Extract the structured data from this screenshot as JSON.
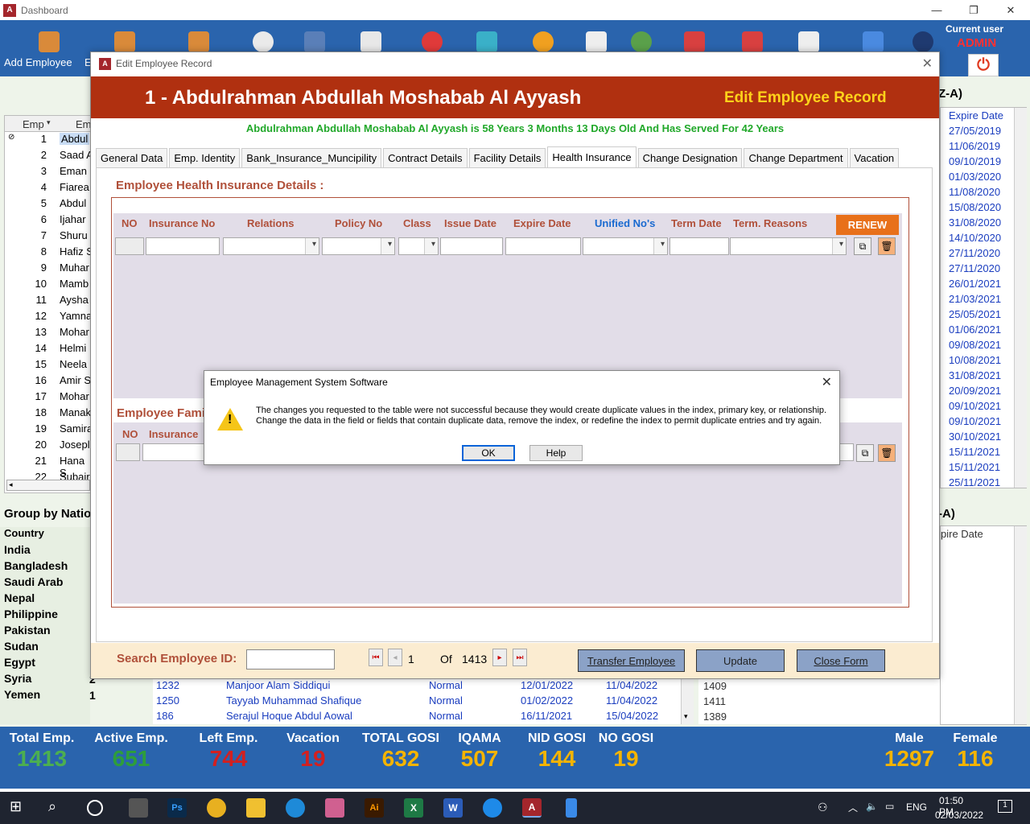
{
  "app": {
    "title": "Dashboard"
  },
  "ribbon": {
    "add_employee": "Add Employee",
    "next_label": "E",
    "current_user_label": "Current user",
    "user": "ADMIN"
  },
  "left_grid": {
    "headers": [
      "Emp",
      "Em"
    ],
    "rows": [
      {
        "n": "1",
        "name": "Abdul"
      },
      {
        "n": "2",
        "name": "Saad A"
      },
      {
        "n": "3",
        "name": "Eman"
      },
      {
        "n": "4",
        "name": "Fiarea"
      },
      {
        "n": "5",
        "name": "Abdul"
      },
      {
        "n": "6",
        "name": "Ijahar"
      },
      {
        "n": "7",
        "name": "Shuru"
      },
      {
        "n": "8",
        "name": "Hafiz S"
      },
      {
        "n": "9",
        "name": "Muhar"
      },
      {
        "n": "10",
        "name": "Mamb"
      },
      {
        "n": "11",
        "name": "Aysha"
      },
      {
        "n": "12",
        "name": "Yamna"
      },
      {
        "n": "13",
        "name": "Mohar"
      },
      {
        "n": "14",
        "name": "Helmi"
      },
      {
        "n": "15",
        "name": "Neela"
      },
      {
        "n": "16",
        "name": "Amir S"
      },
      {
        "n": "17",
        "name": "Mohar"
      },
      {
        "n": "18",
        "name": "Manak"
      },
      {
        "n": "19",
        "name": "Samira"
      },
      {
        "n": "20",
        "name": "Josepl"
      },
      {
        "n": "21",
        "name": "Hana S"
      },
      {
        "n": "22",
        "name": "Subair"
      }
    ]
  },
  "right_grid": {
    "title": "Z-A)",
    "header": "Expire Date",
    "dates": [
      "27/05/2019",
      "11/06/2019",
      "09/10/2019",
      "01/03/2020",
      "11/08/2020",
      "15/08/2020",
      "31/08/2020",
      "14/10/2020",
      "27/11/2020",
      "27/11/2020",
      "26/01/2021",
      "21/03/2021",
      "25/05/2021",
      "01/06/2021",
      "09/08/2021",
      "10/08/2021",
      "31/08/2021",
      "20/09/2021",
      "09/10/2021",
      "09/10/2021",
      "30/10/2021",
      "15/11/2021",
      "15/11/2021",
      "25/11/2021"
    ]
  },
  "right_grid2": {
    "title": "-A)",
    "header": "pire Date"
  },
  "group_nat": {
    "title": "Group by Natio",
    "header": "Country",
    "countries": [
      "India",
      "Bangladesh",
      "Saudi Arab",
      "Nepal",
      "Philippine",
      "Pakistan",
      "Sudan",
      "Egypt",
      "Syria",
      "Yemen"
    ],
    "counts": [
      "2",
      "1"
    ]
  },
  "bottom_rows": [
    {
      "id": "1232",
      "name": "Manjoor Alam Siddiqui",
      "type": "Normal",
      "d1": "12/01/2022",
      "d2": "11/04/2022",
      "c": "1409"
    },
    {
      "id": "1250",
      "name": "Tayyab Muhammad Shafique",
      "type": "Normal",
      "d1": "01/02/2022",
      "d2": "11/04/2022",
      "c": "1411"
    },
    {
      "id": "186",
      "name": "Serajul Hoque Abdul Aowal",
      "type": "Normal",
      "d1": "16/11/2021",
      "d2": "15/04/2022",
      "c": "1389"
    }
  ],
  "stats": [
    {
      "label": "Total Emp.",
      "value": "1413",
      "color": "#4caf50"
    },
    {
      "label": "Active Emp.",
      "value": "651",
      "color": "#2e9e3a"
    },
    {
      "label": "Left Emp.",
      "value": "744",
      "color": "#d32020"
    },
    {
      "label": "Vacation",
      "value": "19",
      "color": "#d32020"
    },
    {
      "label": "TOTAL GOSI",
      "value": "632",
      "color": "#f5b400"
    },
    {
      "label": "IQAMA",
      "value": "507",
      "color": "#f5b400"
    },
    {
      "label": "NID GOSI",
      "value": "144",
      "color": "#f5b400"
    },
    {
      "label": "NO GOSI",
      "value": "19",
      "color": "#f5b400"
    },
    {
      "label": "Male",
      "value": "1297",
      "color": "#f5b400"
    },
    {
      "label": "Female",
      "value": "116",
      "color": "#f5b400"
    }
  ],
  "form": {
    "title": "Edit Employee Record",
    "banner_name": "1 - Abdulrahman Abdullah Moshabab Al Ayyash",
    "banner_right": "Edit Employee Record",
    "age_line": "Abdulrahman Abdullah Moshabab Al Ayyash is 58 Years 3 Months 13 Days Old And Has Served For 42 Years",
    "tabs": [
      "General Data",
      "Emp. Identity",
      "Bank_Insurance_Muncipility",
      "Contract Details",
      "Facility Details",
      "Health Insurance",
      "Change Designation",
      "Change Department",
      "Vacation"
    ],
    "section1": "Employee Health Insurance Details :",
    "ins_headers": [
      "NO",
      "Insurance No",
      "Relations",
      "Policy No",
      "Class",
      "Issue Date",
      "Expire Date",
      "Unified No's",
      "Term Date",
      "Term. Reasons"
    ],
    "renew": "RENEW",
    "section2": "Employee Fami",
    "fam_headers": [
      "NO",
      "Insurance"
    ],
    "search_label": "Search Employee ID:",
    "record_num": "1",
    "of_label": "Of",
    "record_total": "1413",
    "transfer": "Transfer Employee",
    "update": "Update",
    "close": "Close Form"
  },
  "dialog": {
    "title": "Employee Management System Software",
    "message": "The changes you requested to the table were not successful because they would create duplicate values in the index, primary key, or relationship. Change the data in the field or fields that contain duplicate data, remove the index, or redefine the index to permit duplicate entries and try again.",
    "ok": "OK",
    "help": "Help"
  },
  "tray": {
    "lang": "ENG",
    "time": "01:50 PM",
    "date": "02/03/2022",
    "notif": "1"
  }
}
